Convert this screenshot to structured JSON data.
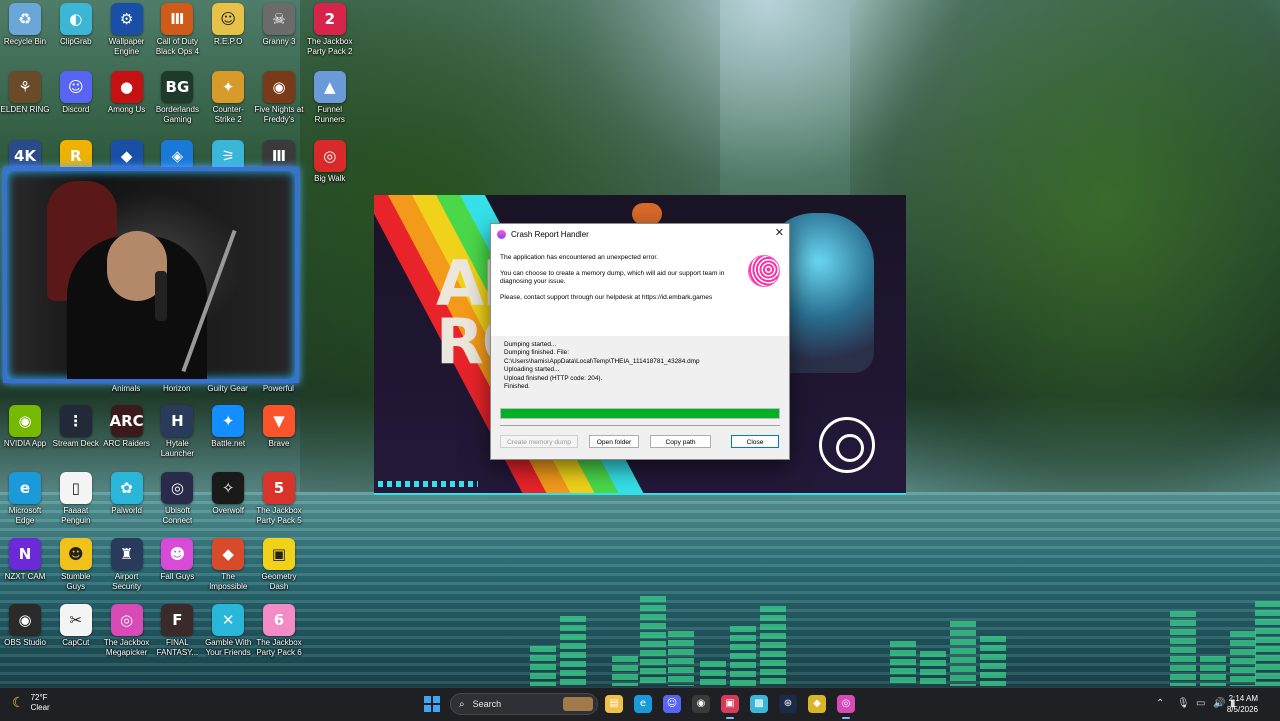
{
  "desktop": {
    "icons_top": [
      {
        "label": "Recycle Bin",
        "icon": "recycle-bin-icon",
        "color": "#6aa6d8",
        "glyph": "♻"
      },
      {
        "label": "ClipGrab",
        "icon": "clipgrab-icon",
        "color": "#3db6d6",
        "glyph": "◐"
      },
      {
        "label": "Wallpaper Engine",
        "icon": "wallpaper-engine-icon",
        "color": "#1a4fa8",
        "glyph": "⚙"
      },
      {
        "label": "Call of Duty Black Ops 4",
        "icon": "call-of-duty-icon",
        "color": "#d05a1a",
        "glyph": "Ⅲ"
      },
      {
        "label": "R.E.P.O",
        "icon": "repo-icon",
        "color": "#e6c24a",
        "glyph": "☺"
      },
      {
        "label": "Granny 3",
        "icon": "granny-icon",
        "color": "#6b6b6b",
        "glyph": "☠"
      },
      {
        "label": "The Jackbox Party Pack 2",
        "icon": "jackbox-icon",
        "color": "#d8234a",
        "glyph": "2"
      }
    ],
    "icons_row2": [
      {
        "label": "ELDEN RING",
        "icon": "elden-ring-icon",
        "color": "#6b4a2a",
        "glyph": "⚘"
      },
      {
        "label": "Discord",
        "icon": "discord-icon",
        "color": "#5865f2",
        "glyph": "☺"
      },
      {
        "label": "Among Us",
        "icon": "among-us-icon",
        "color": "#c51111",
        "glyph": "●"
      },
      {
        "label": "Borderlands Gaming",
        "icon": "borderlands-icon",
        "color": "#1f3a2a",
        "glyph": "BG"
      },
      {
        "label": "Counter-Strike 2",
        "icon": "counter-strike-icon",
        "color": "#d89a2a",
        "glyph": "✦"
      },
      {
        "label": "Five Nights at Freddy's",
        "icon": "fnaf-icon",
        "color": "#7a3a1a",
        "glyph": "◉"
      },
      {
        "label": "Funnel Runners",
        "icon": "funnel-runners-icon",
        "color": "#6a9ad8",
        "glyph": "▲"
      }
    ],
    "icons_row3": [
      {
        "label": "",
        "icon": "4k-video-icon",
        "color": "#2b4a8a",
        "glyph": "4K"
      },
      {
        "label": "",
        "icon": "rockstar-icon",
        "color": "#f0b100",
        "glyph": "R"
      },
      {
        "label": "",
        "icon": "rocket-league-icon",
        "color": "#1a4fa8",
        "glyph": "◆"
      },
      {
        "label": "",
        "icon": "controller-icon",
        "color": "#1a78d8",
        "glyph": "◈"
      },
      {
        "label": "",
        "icon": "gog-icon",
        "color": "#3ab6d8",
        "glyph": "⚞"
      },
      {
        "label": "",
        "icon": "black-ops-icon",
        "color": "#3a3a3a",
        "glyph": "Ⅲ"
      },
      {
        "label": "Big Walk",
        "icon": "big-walk-icon",
        "color": "#d82a2a",
        "glyph": "◎"
      }
    ],
    "icons_mid": [
      {
        "label": "NVIDIA App",
        "icon": "nvidia-icon",
        "color": "#76b900",
        "glyph": "◉"
      },
      {
        "label": "Stream Deck",
        "icon": "stream-deck-icon",
        "color": "#222a3a",
        "glyph": "⋮"
      },
      {
        "label": "ARC Raiders",
        "icon": "arc-raiders-icon",
        "color": "#3a1a1a",
        "glyph": "ARC"
      },
      {
        "label": "Hytale Launcher",
        "icon": "hytale-icon",
        "color": "#2a3a5a",
        "glyph": "H"
      },
      {
        "label": "Battle.net",
        "icon": "battle-net-icon",
        "color": "#148eff",
        "glyph": "✦"
      },
      {
        "label": "Brave",
        "icon": "brave-icon",
        "color": "#fb542b",
        "glyph": "▼"
      }
    ],
    "icons_row5": [
      {
        "label": "Microsoft Edge",
        "icon": "edge-icon",
        "color": "#1a9ad8",
        "glyph": "e"
      },
      {
        "label": "Faaaat Penguin",
        "icon": "faaaat-penguin-icon",
        "color": "#f4f4f4",
        "glyph": "▯"
      },
      {
        "label": "Palworld",
        "icon": "palworld-icon",
        "color": "#2ab6d8",
        "glyph": "✿"
      },
      {
        "label": "Ubisoft Connect",
        "icon": "ubisoft-icon",
        "color": "#2a2a4a",
        "glyph": "◎"
      },
      {
        "label": "Overwolf",
        "icon": "overwolf-icon",
        "color": "#1a1a1a",
        "glyph": "✧"
      },
      {
        "label": "The Jackbox Party Pack 5",
        "icon": "jackbox-5-icon",
        "color": "#d8342a",
        "glyph": "5"
      }
    ],
    "icons_row6": [
      {
        "label": "NZXT CAM",
        "icon": "nzxt-icon",
        "color": "#6a2ad8",
        "glyph": "N"
      },
      {
        "label": "Stumble Guys",
        "icon": "stumble-guys-icon",
        "color": "#f0c21a",
        "glyph": "☻"
      },
      {
        "label": "Airport Security",
        "icon": "airport-security-icon",
        "color": "#2a3a5a",
        "glyph": "♜"
      },
      {
        "label": "Fall Guys",
        "icon": "fall-guys-icon",
        "color": "#d84ad8",
        "glyph": "☻"
      },
      {
        "label": "The Impossible",
        "icon": "impossible-icon",
        "color": "#d84a2a",
        "glyph": "◆"
      },
      {
        "label": "Geometry Dash",
        "icon": "geometry-dash-icon",
        "color": "#f0d21a",
        "glyph": "▣"
      }
    ],
    "icons_row7": [
      {
        "label": "OBS Studio",
        "icon": "obs-icon",
        "color": "#2a2a2a",
        "glyph": "◉"
      },
      {
        "label": "CapCut",
        "icon": "capcut-icon",
        "color": "#f4f4f4",
        "glyph": "✂"
      },
      {
        "label": "The Jackbox Megapicker",
        "icon": "jackbox-megapicker-icon",
        "color": "#d84ab6",
        "glyph": "◎"
      },
      {
        "label": "FINAL FANTASY...",
        "icon": "final-fantasy-icon",
        "color": "#3a2a2a",
        "glyph": "F"
      },
      {
        "label": "Gamble With Your Friends",
        "icon": "gamble-icon",
        "color": "#2ab6d8",
        "glyph": "✕"
      },
      {
        "label": "The Jackbox Party Pack 6",
        "icon": "jackbox-6-icon",
        "color": "#f48ac6",
        "glyph": "6"
      }
    ],
    "covered_labels": [
      "Animals",
      "Horizon",
      "Guilty Gear",
      "Powerful"
    ]
  },
  "dialog": {
    "title": "Crash Report Handler",
    "close_glyph": "✕",
    "message_1": "The application has encountered an unexpected error.",
    "message_2": "You can choose to create a memory dump, which will aid our support team in diagnosing your issue.",
    "message_3": "Please, contact support through our helpdesk at https://id.embark.games",
    "log_lines": [
      "Dumping started...",
      "Dumping finished. File:",
      "C:\\Users\\hamis\\AppData\\Local\\Temp\\THEIA_111418781_43284.dmp",
      "Uploading started...",
      "Upload finished (HTTP code: 204).",
      "Finished."
    ],
    "progress_fraction": 1.0,
    "progress_color": "#06b025",
    "buttons": {
      "create_dump": "Create memory dump",
      "open_folder": "Open folder",
      "copy_path": "Copy path",
      "close": "Close"
    }
  },
  "game_window": {
    "splash_text": "AR\nRO",
    "accent_color": "#36e0e8"
  },
  "taskbar": {
    "weather_temp": "72°F",
    "weather_desc": "Clear",
    "search_placeholder": "Search",
    "time": "2:14 AM",
    "date": "8/5/2026",
    "apps": [
      "file-explorer-icon",
      "edge-icon",
      "discord-icon",
      "chrome-icon",
      "game-icon",
      "photos-icon",
      "steam-icon",
      "app-icon",
      "arc-raiders-icon"
    ],
    "tray_icons": [
      "chevron-up-icon",
      "mic-icon",
      "network-icon",
      "volume-icon",
      "battery-icon"
    ]
  }
}
